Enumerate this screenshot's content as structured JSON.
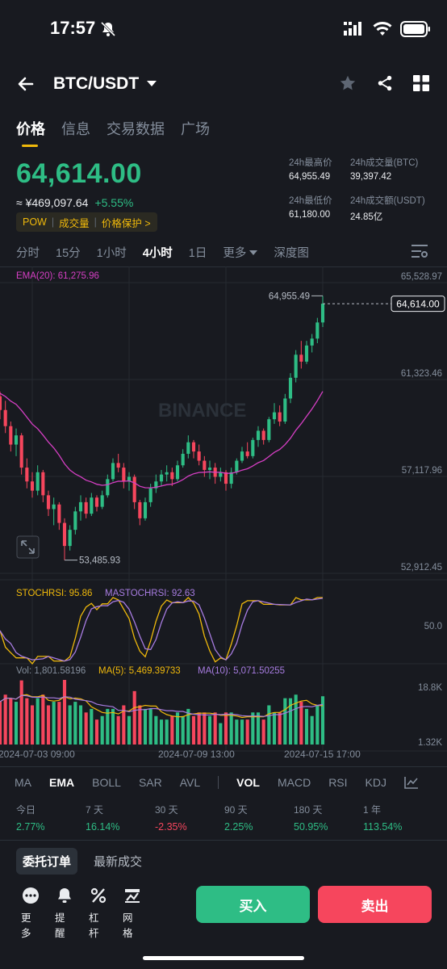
{
  "status": {
    "time": "17:57"
  },
  "header": {
    "pair": "BTC/USDT"
  },
  "tabs": [
    "价格",
    "信息",
    "交易数据",
    "广场"
  ],
  "price": {
    "last": "64,614.00",
    "cny": "≈ ¥469,097.64",
    "change": "+5.55%",
    "tags": [
      "POW",
      "成交量",
      "价格保护 >"
    ]
  },
  "stats": {
    "high_label": "24h最高价",
    "high": "64,955.49",
    "vol_btc_label": "24h成交量(BTC)",
    "vol_btc": "39,397.42",
    "low_label": "24h最低价",
    "low": "61,180.00",
    "vol_usdt_label": "24h成交额(USDT)",
    "vol_usdt": "24.85亿"
  },
  "intervals": [
    "分时",
    "15分",
    "1小时",
    "4小时",
    "1日",
    "更多",
    "深度图"
  ],
  "active_interval": "4小时",
  "chart_data": {
    "type": "candlestick",
    "ema_label": "EMA(20): 61,275.96",
    "y_ticks": [
      "65,528.97",
      "61,323.46",
      "57,117.96",
      "52,912.45"
    ],
    "y_range": [
      52912.45,
      65528.97
    ],
    "last_price_label": "64,614.00",
    "high_marker": "64,955.49",
    "low_marker": "53,485.93",
    "watermark": "BINANCE",
    "candles": [
      [
        60600,
        60800,
        59600,
        60000
      ],
      [
        60000,
        60400,
        59000,
        59300
      ],
      [
        59300,
        59500,
        58200,
        58500
      ],
      [
        58500,
        59200,
        58000,
        58900
      ],
      [
        58900,
        59000,
        57200,
        57500
      ],
      [
        57500,
        57900,
        56600,
        56900
      ],
      [
        56900,
        57300,
        56200,
        56500
      ],
      [
        56500,
        57600,
        56300,
        57300
      ],
      [
        57300,
        57400,
        56000,
        56300
      ],
      [
        56300,
        56500,
        55400,
        55700
      ],
      [
        55700,
        56200,
        55000,
        55900
      ],
      [
        55900,
        56000,
        54800,
        55100
      ],
      [
        55100,
        55300,
        53486,
        54100
      ],
      [
        54100,
        55000,
        53900,
        54800
      ],
      [
        54800,
        55800,
        54600,
        55600
      ],
      [
        55600,
        56300,
        55200,
        56000
      ],
      [
        56000,
        56200,
        55300,
        55500
      ],
      [
        55500,
        56400,
        55400,
        56200
      ],
      [
        56200,
        56300,
        55600,
        55800
      ],
      [
        55800,
        56500,
        55700,
        56300
      ],
      [
        56300,
        57200,
        56200,
        57000
      ],
      [
        57000,
        57900,
        56900,
        57700
      ],
      [
        57700,
        58100,
        57300,
        57500
      ],
      [
        57500,
        57700,
        56600,
        56900
      ],
      [
        56900,
        57300,
        56500,
        57100
      ],
      [
        57100,
        57200,
        55700,
        56000
      ],
      [
        56000,
        56100,
        55000,
        55300
      ],
      [
        55300,
        56200,
        55200,
        56000
      ],
      [
        56000,
        56800,
        55800,
        56600
      ],
      [
        56600,
        57200,
        56400,
        56900
      ],
      [
        56900,
        57400,
        56700,
        57200
      ],
      [
        57200,
        57600,
        56900,
        57300
      ],
      [
        57300,
        57500,
        56700,
        57000
      ],
      [
        57000,
        57800,
        56900,
        57600
      ],
      [
        57600,
        58300,
        57500,
        58100
      ],
      [
        58100,
        58900,
        57900,
        58600
      ],
      [
        58600,
        58700,
        57900,
        58200
      ],
      [
        58200,
        58500,
        57600,
        57800
      ],
      [
        57800,
        58000,
        57100,
        57400
      ],
      [
        57400,
        57800,
        57000,
        57500
      ],
      [
        57500,
        57700,
        56800,
        57100
      ],
      [
        57100,
        57500,
        56900,
        57300
      ],
      [
        57300,
        57400,
        56500,
        56800
      ],
      [
        56800,
        57500,
        56600,
        57300
      ],
      [
        57300,
        57900,
        57200,
        57800
      ],
      [
        57800,
        58400,
        57700,
        58200
      ],
      [
        58200,
        58600,
        57900,
        58000
      ],
      [
        58000,
        58800,
        57900,
        58700
      ],
      [
        58700,
        59300,
        58400,
        59100
      ],
      [
        59100,
        59200,
        58500,
        58700
      ],
      [
        58700,
        59700,
        58600,
        59600
      ],
      [
        59600,
        60300,
        59400,
        59900
      ],
      [
        59900,
        60200,
        59300,
        59500
      ],
      [
        59500,
        60700,
        59400,
        60500
      ],
      [
        60500,
        61600,
        60300,
        61400
      ],
      [
        61400,
        62600,
        61200,
        62400
      ],
      [
        62400,
        63000,
        61800,
        62100
      ],
      [
        62100,
        63000,
        62000,
        62800
      ],
      [
        62800,
        63300,
        62500,
        63100
      ],
      [
        63100,
        64000,
        62900,
        63800
      ],
      [
        63800,
        64955.49,
        63600,
        64614
      ]
    ]
  },
  "stochrsi": {
    "label": "STOCHRSI: 95.86",
    "ma_label": "MASTOCHRSI: 92.63",
    "tick": "50.0"
  },
  "volume": {
    "label": "Vol: 1,801.58196",
    "ma5_label": "MA(5): 5,469.39733",
    "ma10_label": "MA(10): 5,071.50255",
    "ticks": [
      "18.8K",
      "1.32K"
    ],
    "dates": [
      "2024-07-03 09:00",
      "2024-07-09 13:00",
      "2024-07-15 17:00"
    ]
  },
  "indicators": [
    "MA",
    "EMA",
    "BOLL",
    "SAR",
    "AVL",
    "VOL",
    "MACD",
    "RSI",
    "KDJ"
  ],
  "performance": [
    {
      "label": "今日",
      "value": "2.77%",
      "dir": "up"
    },
    {
      "label": "7 天",
      "value": "16.14%",
      "dir": "up"
    },
    {
      "label": "30 天",
      "value": "-2.35%",
      "dir": "down"
    },
    {
      "label": "90 天",
      "value": "2.25%",
      "dir": "up"
    },
    {
      "label": "180 天",
      "value": "50.95%",
      "dir": "up"
    },
    {
      "label": "1 年",
      "value": "113.54%",
      "dir": "up"
    }
  ],
  "order_tabs": [
    "委托订单",
    "最新成交"
  ],
  "actions": [
    "更多",
    "提醒",
    "杠杆",
    "网格"
  ],
  "buy_label": "买入",
  "sell_label": "卖出",
  "colors": {
    "up": "#2ebd85",
    "down": "#f6465d",
    "accent": "#f0b90b",
    "ema": "#d63fc4"
  }
}
